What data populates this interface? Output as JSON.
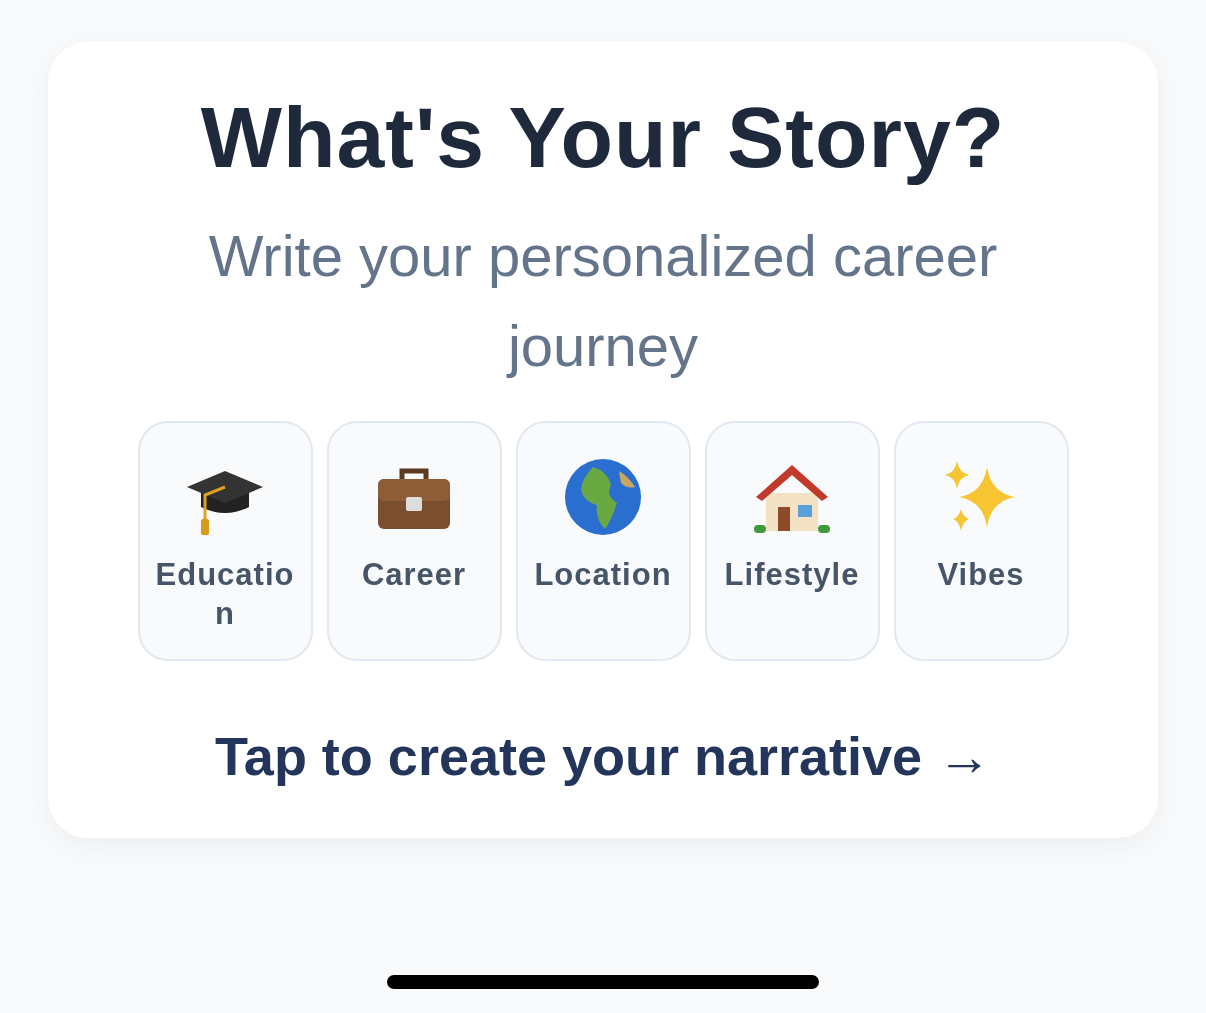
{
  "card": {
    "title": "What's Your Story?",
    "subtitle": "Write your personalized career journey",
    "categories": [
      {
        "label": "Education"
      },
      {
        "label": "Career"
      },
      {
        "label": "Location"
      },
      {
        "label": "Lifestyle"
      },
      {
        "label": "Vibes"
      }
    ],
    "cta": "Tap to create your narrative →"
  }
}
